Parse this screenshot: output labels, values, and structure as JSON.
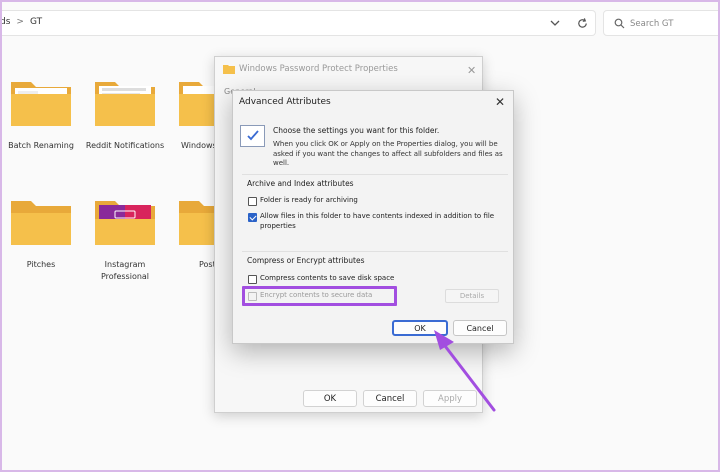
{
  "explorer": {
    "breadcrumb": [
      {
        "label": "ds"
      },
      {
        "label": "GT"
      }
    ],
    "search_placeholder": "Search GT",
    "folders_row1": [
      {
        "label": "Batch Renaming"
      },
      {
        "label": "Reddit Notifications"
      },
      {
        "label": "Windows"
      }
    ],
    "folders_row2": [
      {
        "label": "Pitches"
      },
      {
        "label": "Instagram Professional"
      },
      {
        "label": "Post"
      }
    ]
  },
  "properties_window": {
    "title": "Windows Password Protect Properties",
    "tab_text": "General",
    "ok_label": "OK",
    "cancel_label": "Cancel",
    "apply_label": "Apply"
  },
  "advanced_dialog": {
    "title": "Advanced Attributes",
    "close_glyph": "✕",
    "heading": "Choose the settings you want for this folder.",
    "description": "When you click OK or Apply on the Properties dialog, you will be asked if you want the changes to affect all subfolders and files as well.",
    "archive_group": {
      "title": "Archive and Index attributes",
      "options": [
        {
          "label": "Folder is ready for archiving",
          "checked": false
        },
        {
          "label": "Allow files in this folder to have contents indexed in addition to file properties",
          "checked": true
        }
      ]
    },
    "compress_group": {
      "title": "Compress or Encrypt attributes",
      "options": [
        {
          "label": "Compress contents to save disk space",
          "checked": false
        },
        {
          "label": "Encrypt contents to secure data",
          "checked": false
        }
      ],
      "details_label": "Details"
    },
    "ok_label": "OK",
    "cancel_label": "Cancel"
  },
  "colors": {
    "highlight": "#a24ee0",
    "folder_yellow": "#f5c04b",
    "accent_blue": "#2a62c8"
  },
  "icons": [
    "chevron-down-icon",
    "refresh-icon",
    "search-icon",
    "folder-icon",
    "close-icon",
    "info-checkmark-icon",
    "pointer-arrow-icon"
  ]
}
